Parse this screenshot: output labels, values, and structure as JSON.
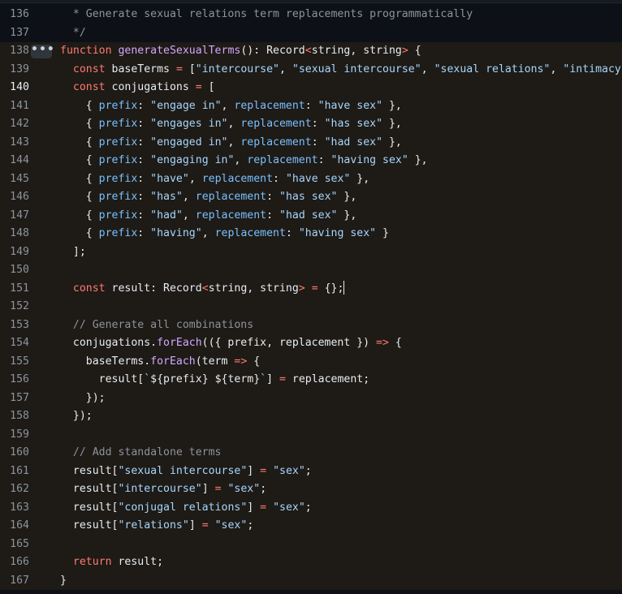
{
  "editor": {
    "expand_glyph": "•••",
    "lines": [
      {
        "num": "136",
        "highlighted": false,
        "active": false,
        "segments": [
          {
            "t": "cmt",
            "v": "  * Generate sexual relations term replacements programmatically"
          }
        ]
      },
      {
        "num": "137",
        "highlighted": false,
        "active": false,
        "segments": [
          {
            "t": "cmt",
            "v": "  */"
          }
        ]
      },
      {
        "num": "138",
        "highlighted": true,
        "active": false,
        "segments": [
          {
            "t": "kw",
            "v": "function "
          },
          {
            "t": "fn",
            "v": "generateSexualTerms"
          },
          {
            "t": "",
            "v": "(): Record"
          },
          {
            "t": "kw",
            "v": "<"
          },
          {
            "t": "",
            "v": "string, string"
          },
          {
            "t": "kw",
            "v": ">"
          },
          {
            "t": "",
            "v": " {"
          }
        ]
      },
      {
        "num": "139",
        "highlighted": true,
        "active": false,
        "segments": [
          {
            "t": "",
            "v": "  "
          },
          {
            "t": "kw",
            "v": "const "
          },
          {
            "t": "",
            "v": "baseTerms "
          },
          {
            "t": "kw",
            "v": "="
          },
          {
            "t": "",
            "v": " ["
          },
          {
            "t": "str",
            "v": "\"intercourse\""
          },
          {
            "t": "",
            "v": ", "
          },
          {
            "t": "str",
            "v": "\"sexual intercourse\""
          },
          {
            "t": "",
            "v": ", "
          },
          {
            "t": "str",
            "v": "\"sexual relations\""
          },
          {
            "t": "",
            "v": ", "
          },
          {
            "t": "str",
            "v": "\"intimacy\""
          },
          {
            "t": "",
            "v": "];"
          }
        ]
      },
      {
        "num": "140",
        "highlighted": true,
        "active": true,
        "segments": [
          {
            "t": "",
            "v": "  "
          },
          {
            "t": "kw",
            "v": "const "
          },
          {
            "t": "",
            "v": "conjugations "
          },
          {
            "t": "kw",
            "v": "="
          },
          {
            "t": "",
            "v": " ["
          }
        ]
      },
      {
        "num": "141",
        "highlighted": true,
        "active": false,
        "segments": [
          {
            "t": "",
            "v": "    { "
          },
          {
            "t": "prop",
            "v": "prefix"
          },
          {
            "t": "",
            "v": ": "
          },
          {
            "t": "str",
            "v": "\"engage in\""
          },
          {
            "t": "",
            "v": ", "
          },
          {
            "t": "prop",
            "v": "replacement"
          },
          {
            "t": "",
            "v": ": "
          },
          {
            "t": "str",
            "v": "\"have sex\""
          },
          {
            "t": "",
            "v": " },"
          }
        ]
      },
      {
        "num": "142",
        "highlighted": true,
        "active": false,
        "segments": [
          {
            "t": "",
            "v": "    { "
          },
          {
            "t": "prop",
            "v": "prefix"
          },
          {
            "t": "",
            "v": ": "
          },
          {
            "t": "str",
            "v": "\"engages in\""
          },
          {
            "t": "",
            "v": ", "
          },
          {
            "t": "prop",
            "v": "replacement"
          },
          {
            "t": "",
            "v": ": "
          },
          {
            "t": "str",
            "v": "\"has sex\""
          },
          {
            "t": "",
            "v": " },"
          }
        ]
      },
      {
        "num": "143",
        "highlighted": true,
        "active": false,
        "segments": [
          {
            "t": "",
            "v": "    { "
          },
          {
            "t": "prop",
            "v": "prefix"
          },
          {
            "t": "",
            "v": ": "
          },
          {
            "t": "str",
            "v": "\"engaged in\""
          },
          {
            "t": "",
            "v": ", "
          },
          {
            "t": "prop",
            "v": "replacement"
          },
          {
            "t": "",
            "v": ": "
          },
          {
            "t": "str",
            "v": "\"had sex\""
          },
          {
            "t": "",
            "v": " },"
          }
        ]
      },
      {
        "num": "144",
        "highlighted": true,
        "active": false,
        "segments": [
          {
            "t": "",
            "v": "    { "
          },
          {
            "t": "prop",
            "v": "prefix"
          },
          {
            "t": "",
            "v": ": "
          },
          {
            "t": "str",
            "v": "\"engaging in\""
          },
          {
            "t": "",
            "v": ", "
          },
          {
            "t": "prop",
            "v": "replacement"
          },
          {
            "t": "",
            "v": ": "
          },
          {
            "t": "str",
            "v": "\"having sex\""
          },
          {
            "t": "",
            "v": " },"
          }
        ]
      },
      {
        "num": "145",
        "highlighted": true,
        "active": false,
        "segments": [
          {
            "t": "",
            "v": "    { "
          },
          {
            "t": "prop",
            "v": "prefix"
          },
          {
            "t": "",
            "v": ": "
          },
          {
            "t": "str",
            "v": "\"have\""
          },
          {
            "t": "",
            "v": ", "
          },
          {
            "t": "prop",
            "v": "replacement"
          },
          {
            "t": "",
            "v": ": "
          },
          {
            "t": "str",
            "v": "\"have sex\""
          },
          {
            "t": "",
            "v": " },"
          }
        ]
      },
      {
        "num": "146",
        "highlighted": true,
        "active": false,
        "segments": [
          {
            "t": "",
            "v": "    { "
          },
          {
            "t": "prop",
            "v": "prefix"
          },
          {
            "t": "",
            "v": ": "
          },
          {
            "t": "str",
            "v": "\"has\""
          },
          {
            "t": "",
            "v": ", "
          },
          {
            "t": "prop",
            "v": "replacement"
          },
          {
            "t": "",
            "v": ": "
          },
          {
            "t": "str",
            "v": "\"has sex\""
          },
          {
            "t": "",
            "v": " },"
          }
        ]
      },
      {
        "num": "147",
        "highlighted": true,
        "active": false,
        "segments": [
          {
            "t": "",
            "v": "    { "
          },
          {
            "t": "prop",
            "v": "prefix"
          },
          {
            "t": "",
            "v": ": "
          },
          {
            "t": "str",
            "v": "\"had\""
          },
          {
            "t": "",
            "v": ", "
          },
          {
            "t": "prop",
            "v": "replacement"
          },
          {
            "t": "",
            "v": ": "
          },
          {
            "t": "str",
            "v": "\"had sex\""
          },
          {
            "t": "",
            "v": " },"
          }
        ]
      },
      {
        "num": "148",
        "highlighted": true,
        "active": false,
        "segments": [
          {
            "t": "",
            "v": "    { "
          },
          {
            "t": "prop",
            "v": "prefix"
          },
          {
            "t": "",
            "v": ": "
          },
          {
            "t": "str",
            "v": "\"having\""
          },
          {
            "t": "",
            "v": ", "
          },
          {
            "t": "prop",
            "v": "replacement"
          },
          {
            "t": "",
            "v": ": "
          },
          {
            "t": "str",
            "v": "\"having sex\""
          },
          {
            "t": "",
            "v": " }"
          }
        ]
      },
      {
        "num": "149",
        "highlighted": true,
        "active": false,
        "segments": [
          {
            "t": "",
            "v": "  ];"
          }
        ]
      },
      {
        "num": "150",
        "highlighted": true,
        "active": false,
        "segments": []
      },
      {
        "num": "151",
        "highlighted": true,
        "active": false,
        "cursor": true,
        "segments": [
          {
            "t": "",
            "v": "  "
          },
          {
            "t": "kw",
            "v": "const "
          },
          {
            "t": "",
            "v": "result: Record"
          },
          {
            "t": "kw",
            "v": "<"
          },
          {
            "t": "",
            "v": "string, string"
          },
          {
            "t": "kw",
            "v": ">"
          },
          {
            "t": "",
            "v": " "
          },
          {
            "t": "kw",
            "v": "="
          },
          {
            "t": "",
            "v": " {};"
          }
        ]
      },
      {
        "num": "152",
        "highlighted": true,
        "active": false,
        "segments": []
      },
      {
        "num": "153",
        "highlighted": true,
        "active": false,
        "segments": [
          {
            "t": "cmt",
            "v": "  // Generate all combinations"
          }
        ]
      },
      {
        "num": "154",
        "highlighted": true,
        "active": false,
        "segments": [
          {
            "t": "",
            "v": "  conjugations."
          },
          {
            "t": "fn",
            "v": "forEach"
          },
          {
            "t": "",
            "v": "(({ prefix, replacement }) "
          },
          {
            "t": "kw",
            "v": "=>"
          },
          {
            "t": "",
            "v": " {"
          }
        ]
      },
      {
        "num": "155",
        "highlighted": true,
        "active": false,
        "segments": [
          {
            "t": "",
            "v": "    baseTerms."
          },
          {
            "t": "fn",
            "v": "forEach"
          },
          {
            "t": "",
            "v": "(term "
          },
          {
            "t": "kw",
            "v": "=>"
          },
          {
            "t": "",
            "v": " {"
          }
        ]
      },
      {
        "num": "156",
        "highlighted": true,
        "active": false,
        "segments": [
          {
            "t": "",
            "v": "      result["
          },
          {
            "t": "str",
            "v": "`"
          },
          {
            "t": "",
            "v": "${prefix} ${term}"
          },
          {
            "t": "str",
            "v": "`"
          },
          {
            "t": "",
            "v": "] "
          },
          {
            "t": "kw",
            "v": "="
          },
          {
            "t": "",
            "v": " replacement;"
          }
        ]
      },
      {
        "num": "157",
        "highlighted": true,
        "active": false,
        "segments": [
          {
            "t": "",
            "v": "    });"
          }
        ]
      },
      {
        "num": "158",
        "highlighted": true,
        "active": false,
        "segments": [
          {
            "t": "",
            "v": "  });"
          }
        ]
      },
      {
        "num": "159",
        "highlighted": true,
        "active": false,
        "segments": []
      },
      {
        "num": "160",
        "highlighted": true,
        "active": false,
        "segments": [
          {
            "t": "cmt",
            "v": "  // Add standalone terms"
          }
        ]
      },
      {
        "num": "161",
        "highlighted": true,
        "active": false,
        "segments": [
          {
            "t": "",
            "v": "  result["
          },
          {
            "t": "str",
            "v": "\"sexual intercourse\""
          },
          {
            "t": "",
            "v": "] "
          },
          {
            "t": "kw",
            "v": "="
          },
          {
            "t": "",
            "v": " "
          },
          {
            "t": "str",
            "v": "\"sex\""
          },
          {
            "t": "",
            "v": ";"
          }
        ]
      },
      {
        "num": "162",
        "highlighted": true,
        "active": false,
        "segments": [
          {
            "t": "",
            "v": "  result["
          },
          {
            "t": "str",
            "v": "\"intercourse\""
          },
          {
            "t": "",
            "v": "] "
          },
          {
            "t": "kw",
            "v": "="
          },
          {
            "t": "",
            "v": " "
          },
          {
            "t": "str",
            "v": "\"sex\""
          },
          {
            "t": "",
            "v": ";"
          }
        ]
      },
      {
        "num": "163",
        "highlighted": true,
        "active": false,
        "segments": [
          {
            "t": "",
            "v": "  result["
          },
          {
            "t": "str",
            "v": "\"conjugal relations\""
          },
          {
            "t": "",
            "v": "] "
          },
          {
            "t": "kw",
            "v": "="
          },
          {
            "t": "",
            "v": " "
          },
          {
            "t": "str",
            "v": "\"sex\""
          },
          {
            "t": "",
            "v": ";"
          }
        ]
      },
      {
        "num": "164",
        "highlighted": true,
        "active": false,
        "segments": [
          {
            "t": "",
            "v": "  result["
          },
          {
            "t": "str",
            "v": "\"relations\""
          },
          {
            "t": "",
            "v": "] "
          },
          {
            "t": "kw",
            "v": "="
          },
          {
            "t": "",
            "v": " "
          },
          {
            "t": "str",
            "v": "\"sex\""
          },
          {
            "t": "",
            "v": ";"
          }
        ]
      },
      {
        "num": "165",
        "highlighted": true,
        "active": false,
        "segments": []
      },
      {
        "num": "166",
        "highlighted": true,
        "active": false,
        "segments": [
          {
            "t": "",
            "v": "  "
          },
          {
            "t": "kw",
            "v": "return "
          },
          {
            "t": "",
            "v": "result;"
          }
        ]
      },
      {
        "num": "167",
        "highlighted": true,
        "active": false,
        "segments": [
          {
            "t": "",
            "v": "}"
          }
        ]
      }
    ]
  },
  "colors": {
    "background": "#0d1117",
    "highlight": "#1e1a15",
    "keyword": "#ff7b72",
    "function": "#d2a8ff",
    "string": "#a5d6ff",
    "property": "#79c0ff",
    "comment": "#8b949e",
    "text": "#e6edf3"
  }
}
